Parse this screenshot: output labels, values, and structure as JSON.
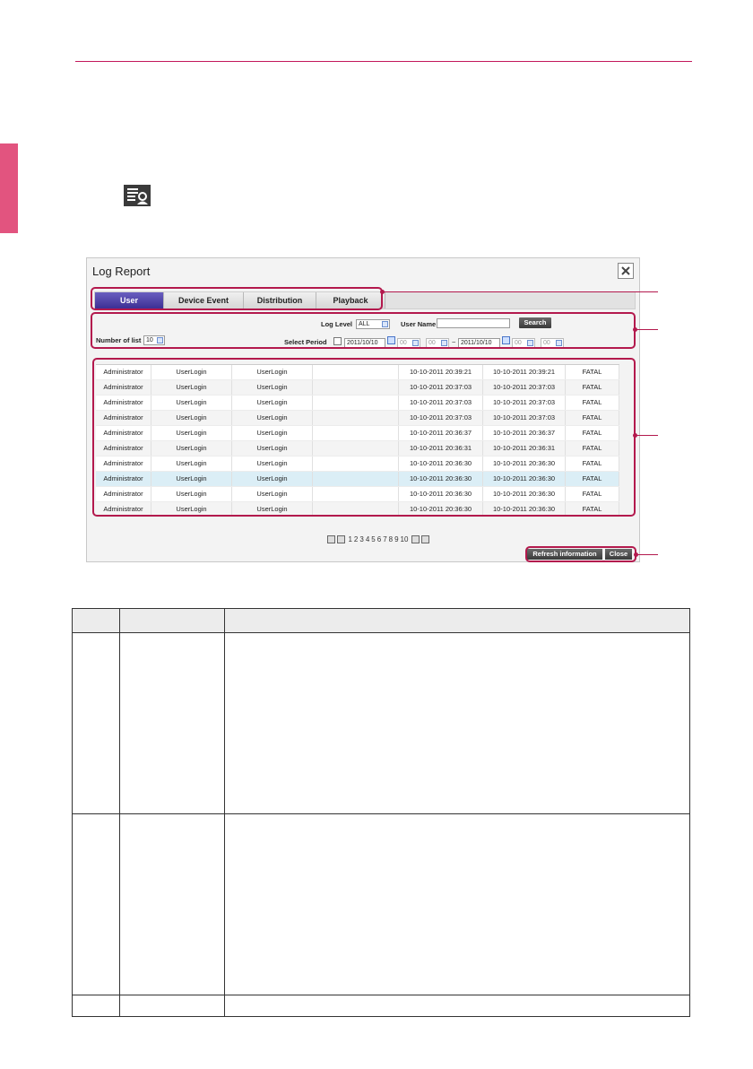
{
  "dialog": {
    "title": "Log Report",
    "close_label": "×"
  },
  "tabs": [
    {
      "label": "User",
      "active": true
    },
    {
      "label": "Device Event",
      "active": false
    },
    {
      "label": "Distribution",
      "active": false
    },
    {
      "label": "Playback",
      "active": false
    }
  ],
  "filter": {
    "log_level_label": "Log Level",
    "log_level_value": "ALL",
    "user_name_label": "User Name",
    "user_name_value": "",
    "search_label": "Search",
    "number_of_list_label": "Number of list",
    "number_of_list_value": "10",
    "select_period_label": "Select Period",
    "start_date": "2011/10/10",
    "start_hour": "00",
    "start_min": "00",
    "period_sep": "~",
    "end_date": "2011/10/10",
    "end_hour": "00",
    "end_min": "00"
  },
  "table": {
    "rows": [
      [
        "Administrator",
        "UserLogin",
        "UserLogin",
        "",
        "10-10-2011 20:39:21",
        "10-10-2011 20:39:21",
        "FATAL"
      ],
      [
        "Administrator",
        "UserLogin",
        "UserLogin",
        "",
        "10-10-2011 20:37:03",
        "10-10-2011 20:37:03",
        "FATAL"
      ],
      [
        "Administrator",
        "UserLogin",
        "UserLogin",
        "",
        "10-10-2011 20:37:03",
        "10-10-2011 20:37:03",
        "FATAL"
      ],
      [
        "Administrator",
        "UserLogin",
        "UserLogin",
        "",
        "10-10-2011 20:37:03",
        "10-10-2011 20:37:03",
        "FATAL"
      ],
      [
        "Administrator",
        "UserLogin",
        "UserLogin",
        "",
        "10-10-2011 20:36:37",
        "10-10-2011 20:36:37",
        "FATAL"
      ],
      [
        "Administrator",
        "UserLogin",
        "UserLogin",
        "",
        "10-10-2011 20:36:31",
        "10-10-2011 20:36:31",
        "FATAL"
      ],
      [
        "Administrator",
        "UserLogin",
        "UserLogin",
        "",
        "10-10-2011 20:36:30",
        "10-10-2011 20:36:30",
        "FATAL"
      ],
      [
        "Administrator",
        "UserLogin",
        "UserLogin",
        "",
        "10-10-2011 20:36:30",
        "10-10-2011 20:36:30",
        "FATAL"
      ],
      [
        "Administrator",
        "UserLogin",
        "UserLogin",
        "",
        "10-10-2011 20:36:30",
        "10-10-2011 20:36:30",
        "FATAL"
      ],
      [
        "Administrator",
        "UserLogin",
        "UserLogin",
        "",
        "10-10-2011 20:36:30",
        "10-10-2011 20:36:30",
        "FATAL"
      ]
    ],
    "selected_row": 7
  },
  "pager": {
    "pages": [
      "1",
      "2",
      "3",
      "4",
      "5",
      "6",
      "7",
      "8",
      "9",
      "10"
    ]
  },
  "buttons": {
    "refresh_label": "Refresh information",
    "close_label": "Close"
  },
  "colors": {
    "accent": "#b3194d",
    "side_tab": "#e2547f",
    "active_tab": "#3c2f94"
  }
}
